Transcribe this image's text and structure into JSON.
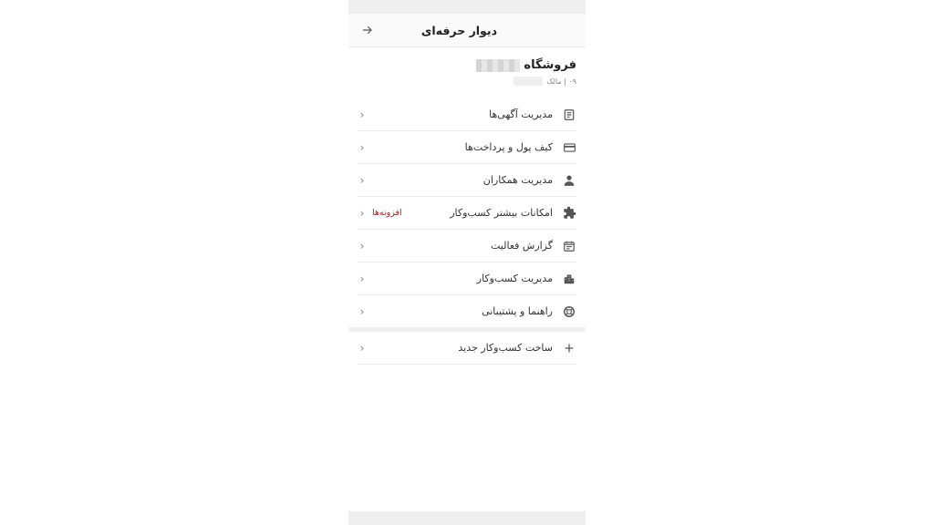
{
  "header": {
    "title": "دیوار حرفه‌ای",
    "back_icon": "arrow-right-icon"
  },
  "profile": {
    "store_label": "فروشگاه",
    "role_text": "۰۹ | مالک"
  },
  "menu": [
    {
      "label": "مدیریت آگهی‌ها",
      "icon": "document-icon",
      "badge": ""
    },
    {
      "label": "کیف پول و پرداخت‌ها",
      "icon": "credit-card-icon",
      "badge": ""
    },
    {
      "label": "مدیریت همکاران",
      "icon": "user-icon",
      "badge": ""
    },
    {
      "label": "امکانات بیشتر کسب‌وکار",
      "icon": "puzzle-icon",
      "badge": "افزونه‌ها"
    },
    {
      "label": "گزارش فعالیت",
      "icon": "calendar-icon",
      "badge": ""
    },
    {
      "label": "مدیریت کسب‌وکار",
      "icon": "building-icon",
      "badge": ""
    },
    {
      "label": "راهنما و پشتیبانی",
      "icon": "lifebuoy-icon",
      "badge": ""
    }
  ],
  "create": {
    "label": "ساخت کسب‌وکار جدید",
    "icon": "plus-icon"
  },
  "colors": {
    "badge": "#a62626",
    "header_bg": "#fafafa",
    "bar_bg": "#eeeeee"
  }
}
